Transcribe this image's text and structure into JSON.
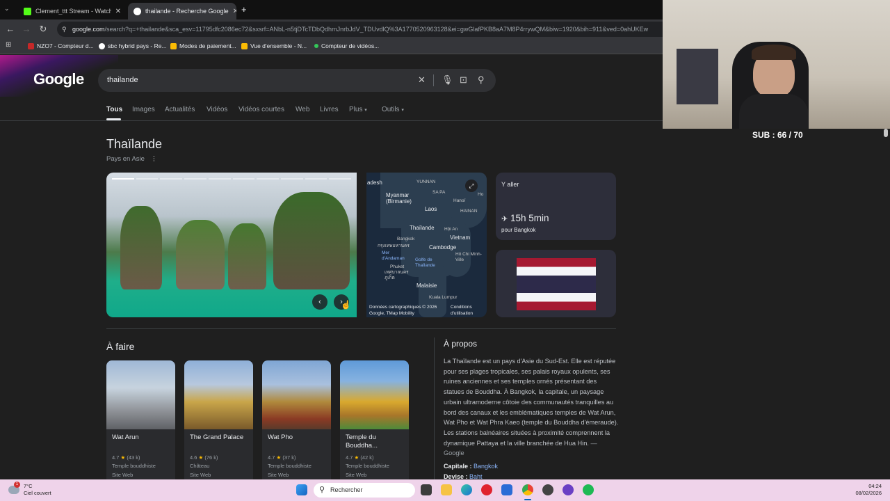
{
  "browser": {
    "tabs": [
      {
        "title": "Clement_ttt Stream - Watch Live",
        "active": false
      },
      {
        "title": "thailande - Recherche Google",
        "active": true
      }
    ],
    "url_host": "google.com",
    "url_rest": "/search?q=+thailande&sca_esv=11795dfc2086ec72&sxsrf=ANbL-n5tjDTcTDbQdhmJnrbJdV_TDUvdlQ%3A1770520963128&ei=gwGlafPKB8aA7M8P4rrywQM&biw=1920&bih=911&ved=0ahUKEw",
    "bookmarks": [
      "NZO7 - Compteur d...",
      "sbc hybrid pays - Re...",
      "Modes de paiement...",
      "Vue d'ensemble - N...",
      "Compteur de vidéos..."
    ]
  },
  "google": {
    "logo": "Google",
    "query": "thailande",
    "tabs": [
      "Tous",
      "Images",
      "Actualités",
      "Vidéos",
      "Vidéos courtes",
      "Web",
      "Livres",
      "Plus",
      "Outils"
    ],
    "active_tab": "Tous"
  },
  "entity": {
    "title": "Thaïlande",
    "subtitle": "Pays en Asie",
    "map_labels": {
      "adesh": "adesh",
      "yunnan": "YUNNAN",
      "myanmar": "Myanmar (Birmanie)",
      "sapa": "SA PA",
      "hanoi": "Hanoï",
      "hainan": "HAINAN",
      "ho": "Ho",
      "laos": "Laos",
      "thailande": "Thaïlande",
      "hoian": "Hội An",
      "bangkok": "Bangkok",
      "bangkok_th": "กรุงเทพมหานคร",
      "vietnam": "Vietnam",
      "cambodge": "Cambodge",
      "mer": "Mer d'Andaman",
      "hochiminh": "Hô Chi Minh-Ville",
      "golfe": "Golfe de Thaïlande",
      "phuket": "Phuket",
      "phuket_th": "เทศบาลนครภูเก็ต",
      "malaisie": "Malaisie",
      "kuala": "Kuala Lumpur",
      "foot_left": "Données cartographiques © 2026 Google, TMap Mobility",
      "foot_right": "Conditions d'utilisation"
    },
    "goto": {
      "title": "Y aller",
      "duration": "15h 5min",
      "dest": "pour Bangkok"
    }
  },
  "afaire": {
    "title": "À faire",
    "items": [
      {
        "name": "Wat Arun",
        "rating": "4.7",
        "reviews": "(43 k)",
        "kind": "Temple bouddhiste",
        "site": "Site Web"
      },
      {
        "name": "The Grand Palace",
        "rating": "4.6",
        "reviews": "(76 k)",
        "kind": "Château",
        "site": "Site Web"
      },
      {
        "name": "Wat Pho",
        "rating": "4.7",
        "reviews": "(37 k)",
        "kind": "Temple bouddhiste",
        "site": "Site Web"
      },
      {
        "name": "Temple du Bouddha...",
        "rating": "4.7",
        "reviews": "(42 k)",
        "kind": "Temple bouddhiste",
        "site": "Site Web"
      }
    ]
  },
  "apropos": {
    "title": "À propos",
    "text": "La Thaïlande est un pays d'Asie du Sud-Est. Elle est réputée pour ses plages tropicales, ses palais royaux opulents, ses ruines anciennes et ses temples ornés présentant des statues de Bouddha. À Bangkok, la capitale, un paysage urbain ultramoderne côtoie des communautés tranquilles au bord des canaux et les emblématiques temples de Wat Arun, Wat Pho et Wat Phra Kaeo (temple du Bouddha d'émeraude). Les stations balnéaires situées à proximité comprennent la dynamique Pattaya et la ville branchée de Hua Hin.",
    "source": "— Google",
    "capitale_label": "Capitale :",
    "capitale_value": "Bangkok",
    "devise_label": "Devise :",
    "devise_value": "Baht"
  },
  "stream": {
    "sub_counter": "SUB : 66 / 70"
  },
  "taskbar": {
    "temp": "7°C",
    "weather": "Ciel couvert",
    "badge": "1",
    "search": "Rechercher",
    "time": "04:24",
    "date": "08/02/2026"
  }
}
